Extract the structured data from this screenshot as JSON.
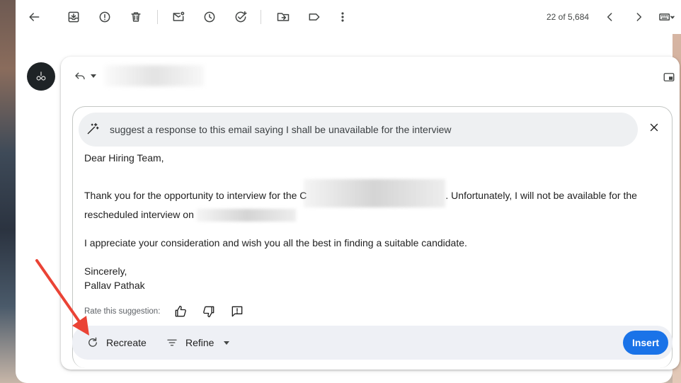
{
  "toolbar": {
    "pager_text": "22 of 5,684",
    "icons": [
      "back-arrow-icon",
      "archive-icon",
      "report-spam-icon",
      "delete-icon",
      "mark-unread-icon",
      "snooze-icon",
      "add-task-icon",
      "move-to-icon",
      "label-icon",
      "more-vert-icon",
      "older-icon",
      "newer-icon",
      "keyboard-icon"
    ]
  },
  "compose": {
    "prompt": "suggest a response to this email saying I shall be unavailable for the interview",
    "body": {
      "greeting": "Dear Hiring Team,",
      "para1_start": "Thank you for the opportunity to interview for the C",
      "para1_mid": ". Unfortunately, I will not be available for the rescheduled interview on",
      "para2": "I appreciate your consideration and wish you all the best in finding a suitable candidate.",
      "closing": "Sincerely,",
      "signature": "Pallav Pathak"
    },
    "rate_label": "Rate this suggestion:",
    "actions": {
      "recreate": "Recreate",
      "refine": "Refine",
      "insert": "Insert"
    }
  },
  "colors": {
    "accent": "#1a73e8",
    "annotation_arrow": "#ea4335"
  }
}
